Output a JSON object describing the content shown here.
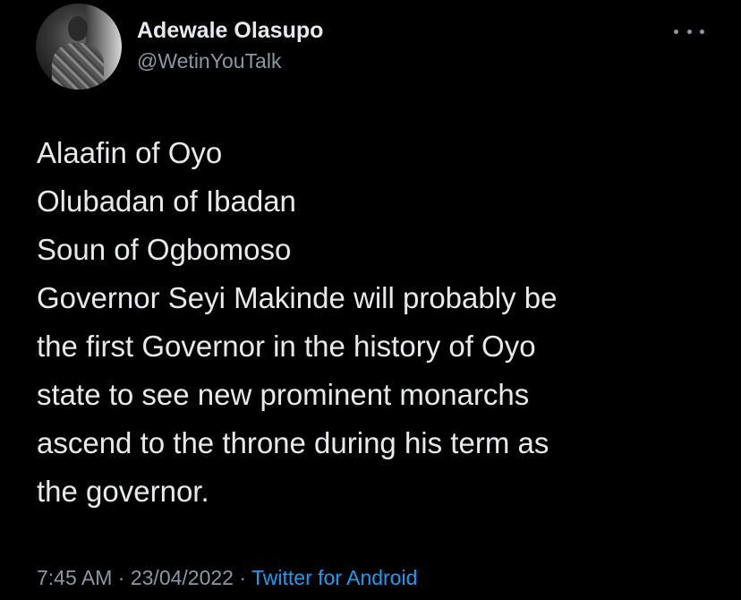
{
  "author": {
    "name": "Adewale Olasupo",
    "handle": "@WetinYouTalk"
  },
  "menu_icon": "more-horizontal-icon",
  "tweet": {
    "lines_block1": [
      "Alaafin of Oyo",
      "Olubadan of Ibadan",
      "Soun of Ogbomoso"
    ],
    "lines_block2": [
      "Governor Seyi Makinde will probably be",
      "the first Governor in the history of Oyo",
      "state to see new prominent monarchs",
      "ascend to the throne during his term as",
      "the governor."
    ]
  },
  "meta": {
    "time": "7:45 AM",
    "separator": "·",
    "date": "23/04/2022",
    "source": "Twitter for Android"
  },
  "colors": {
    "background": "#000000",
    "text": "#e7e9ea",
    "secondary": "#8b98a5",
    "link": "#1d9bf0"
  }
}
